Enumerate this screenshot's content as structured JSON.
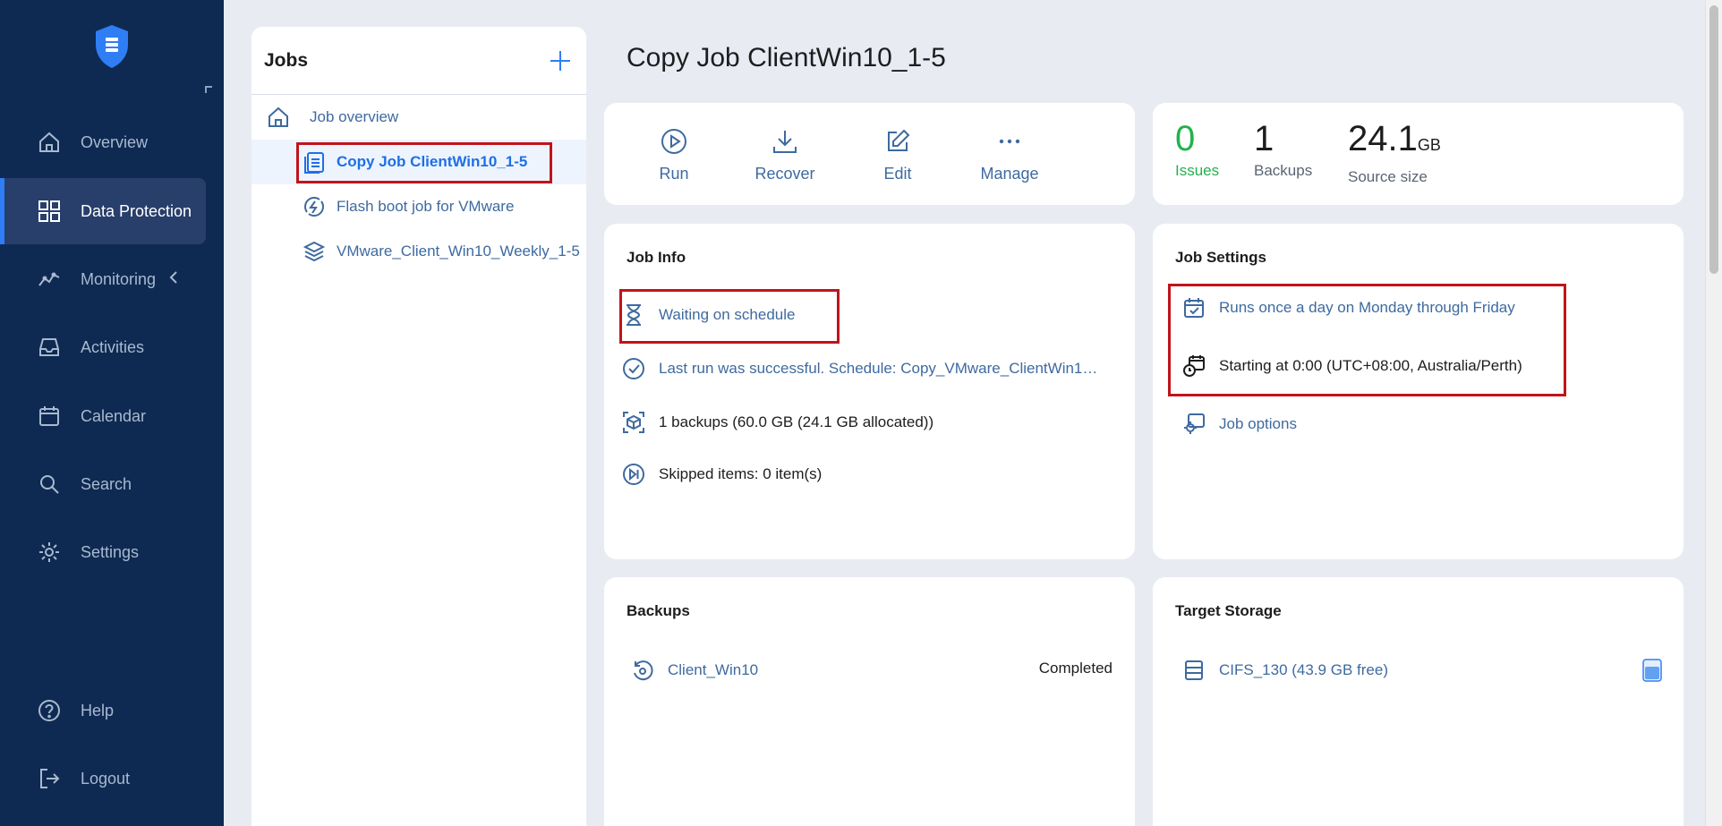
{
  "sidebar": {
    "items": [
      {
        "label": "Overview",
        "icon": "home-icon"
      },
      {
        "label": "Data Protection",
        "icon": "grid-icon"
      },
      {
        "label": "Monitoring",
        "icon": "monitoring-icon"
      },
      {
        "label": "Activities",
        "icon": "inbox-icon"
      },
      {
        "label": "Calendar",
        "icon": "calendar-icon"
      },
      {
        "label": "Search",
        "icon": "search-icon"
      },
      {
        "label": "Settings",
        "icon": "gear-icon"
      },
      {
        "label": "Help",
        "icon": "help-icon"
      },
      {
        "label": "Logout",
        "icon": "logout-icon"
      }
    ],
    "active": "Data Protection"
  },
  "jobs": {
    "title": "Jobs",
    "items": [
      {
        "label": "Job overview",
        "icon": "home-icon"
      },
      {
        "label": "Copy Job ClientWin10_1-5",
        "icon": "copy-job-icon"
      },
      {
        "label": "Flash boot job for VMware",
        "icon": "flash-boot-icon"
      },
      {
        "label": "VMware_Client_Win10_Weekly_1-5",
        "icon": "backup-job-icon"
      }
    ]
  },
  "main": {
    "title": "Copy Job ClientWin10_1-5",
    "actions": [
      {
        "label": "Run",
        "icon": "play-icon"
      },
      {
        "label": "Recover",
        "icon": "download-icon"
      },
      {
        "label": "Edit",
        "icon": "edit-icon"
      },
      {
        "label": "Manage",
        "icon": "more-icon"
      }
    ],
    "stats": {
      "issues": {
        "value": "0",
        "label": "Issues"
      },
      "backups": {
        "value": "1",
        "label": "Backups"
      },
      "source": {
        "value": "24.1",
        "unit": "GB",
        "label": "Source size"
      }
    },
    "job_info": {
      "title": "Job Info",
      "status": "Waiting on schedule",
      "last_run": "Last run was successful. Schedule: Copy_VMware_ClientWin1…",
      "backups": "1 backups (60.0 GB (24.1 GB allocated))",
      "skipped": "Skipped items: 0 item(s)"
    },
    "job_settings": {
      "title": "Job Settings",
      "schedule": "Runs once a day on Monday through Friday",
      "start": "Starting at 0:00 (UTC+08:00, Australia/Perth)",
      "options": "Job options"
    },
    "backups": {
      "title": "Backups",
      "item": "Client_Win10",
      "status": "Completed"
    },
    "target_storage": {
      "title": "Target Storage",
      "item": "CIFS_130 (43.9 GB free)"
    }
  },
  "colors": {
    "sidebar": "#0e2a52",
    "accent": "#2f7ef5",
    "link": "#3e6a9f",
    "success": "#22b14c",
    "highlight": "#c0141b"
  }
}
